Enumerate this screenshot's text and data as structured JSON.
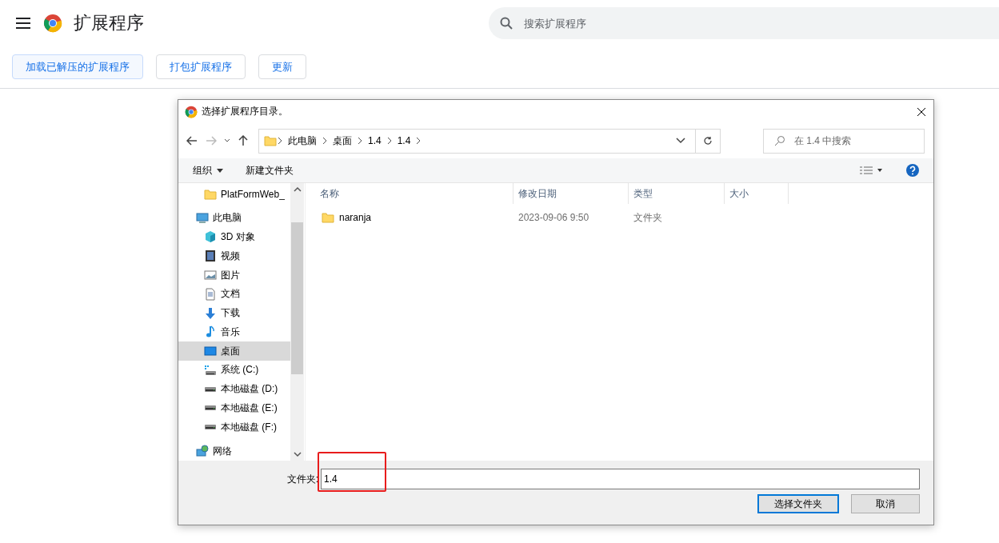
{
  "header": {
    "title": "扩展程序",
    "search_placeholder": "搜索扩展程序"
  },
  "toolbar": [
    {
      "label": "加载已解压的扩展程序",
      "selected": true
    },
    {
      "label": "打包扩展程序",
      "selected": false
    },
    {
      "label": "更新",
      "selected": false
    }
  ],
  "dialog": {
    "title": "选择扩展程序目录。",
    "breadcrumb": [
      "此电脑",
      "桌面",
      "1.4",
      "1.4"
    ],
    "search_placeholder": "在 1.4 中搜索",
    "commands": {
      "organize": "组织",
      "new_folder": "新建文件夹"
    },
    "nav_pane": {
      "partial_group": [
        {
          "label": "PlatFormWeb_",
          "kind": "folder",
          "selected": false
        }
      ],
      "items": [
        {
          "label": "此电脑",
          "kind": "pc",
          "selected": false,
          "children": [
            {
              "label": "3D 对象",
              "kind": "cube",
              "selected": false
            },
            {
              "label": "视频",
              "kind": "film",
              "selected": false
            },
            {
              "label": "图片",
              "kind": "image",
              "selected": false
            },
            {
              "label": "文档",
              "kind": "doc",
              "selected": false
            },
            {
              "label": "下载",
              "kind": "download",
              "selected": false
            },
            {
              "label": "音乐",
              "kind": "music",
              "selected": false
            },
            {
              "label": "桌面",
              "kind": "desktop",
              "selected": true
            },
            {
              "label": "系统 (C:)",
              "kind": "systemdrive",
              "selected": false
            },
            {
              "label": "本地磁盘 (D:)",
              "kind": "drive",
              "selected": false
            },
            {
              "label": "本地磁盘 (E:)",
              "kind": "drive",
              "selected": false
            },
            {
              "label": "本地磁盘 (F:)",
              "kind": "drive",
              "selected": false
            }
          ]
        },
        {
          "label": "网络",
          "kind": "network",
          "selected": false
        }
      ]
    },
    "columns": [
      "名称",
      "修改日期",
      "类型",
      "大小"
    ],
    "rows": [
      {
        "name": "naranja",
        "modified": "2023-09-06 9:50",
        "type": "文件夹",
        "selected": false
      }
    ],
    "folder_label": "文件夹:",
    "folder_value": "1.4",
    "buttons": [
      {
        "label": "选择文件夹",
        "kind": "primary"
      },
      {
        "label": "取消",
        "kind": "normal"
      }
    ]
  }
}
